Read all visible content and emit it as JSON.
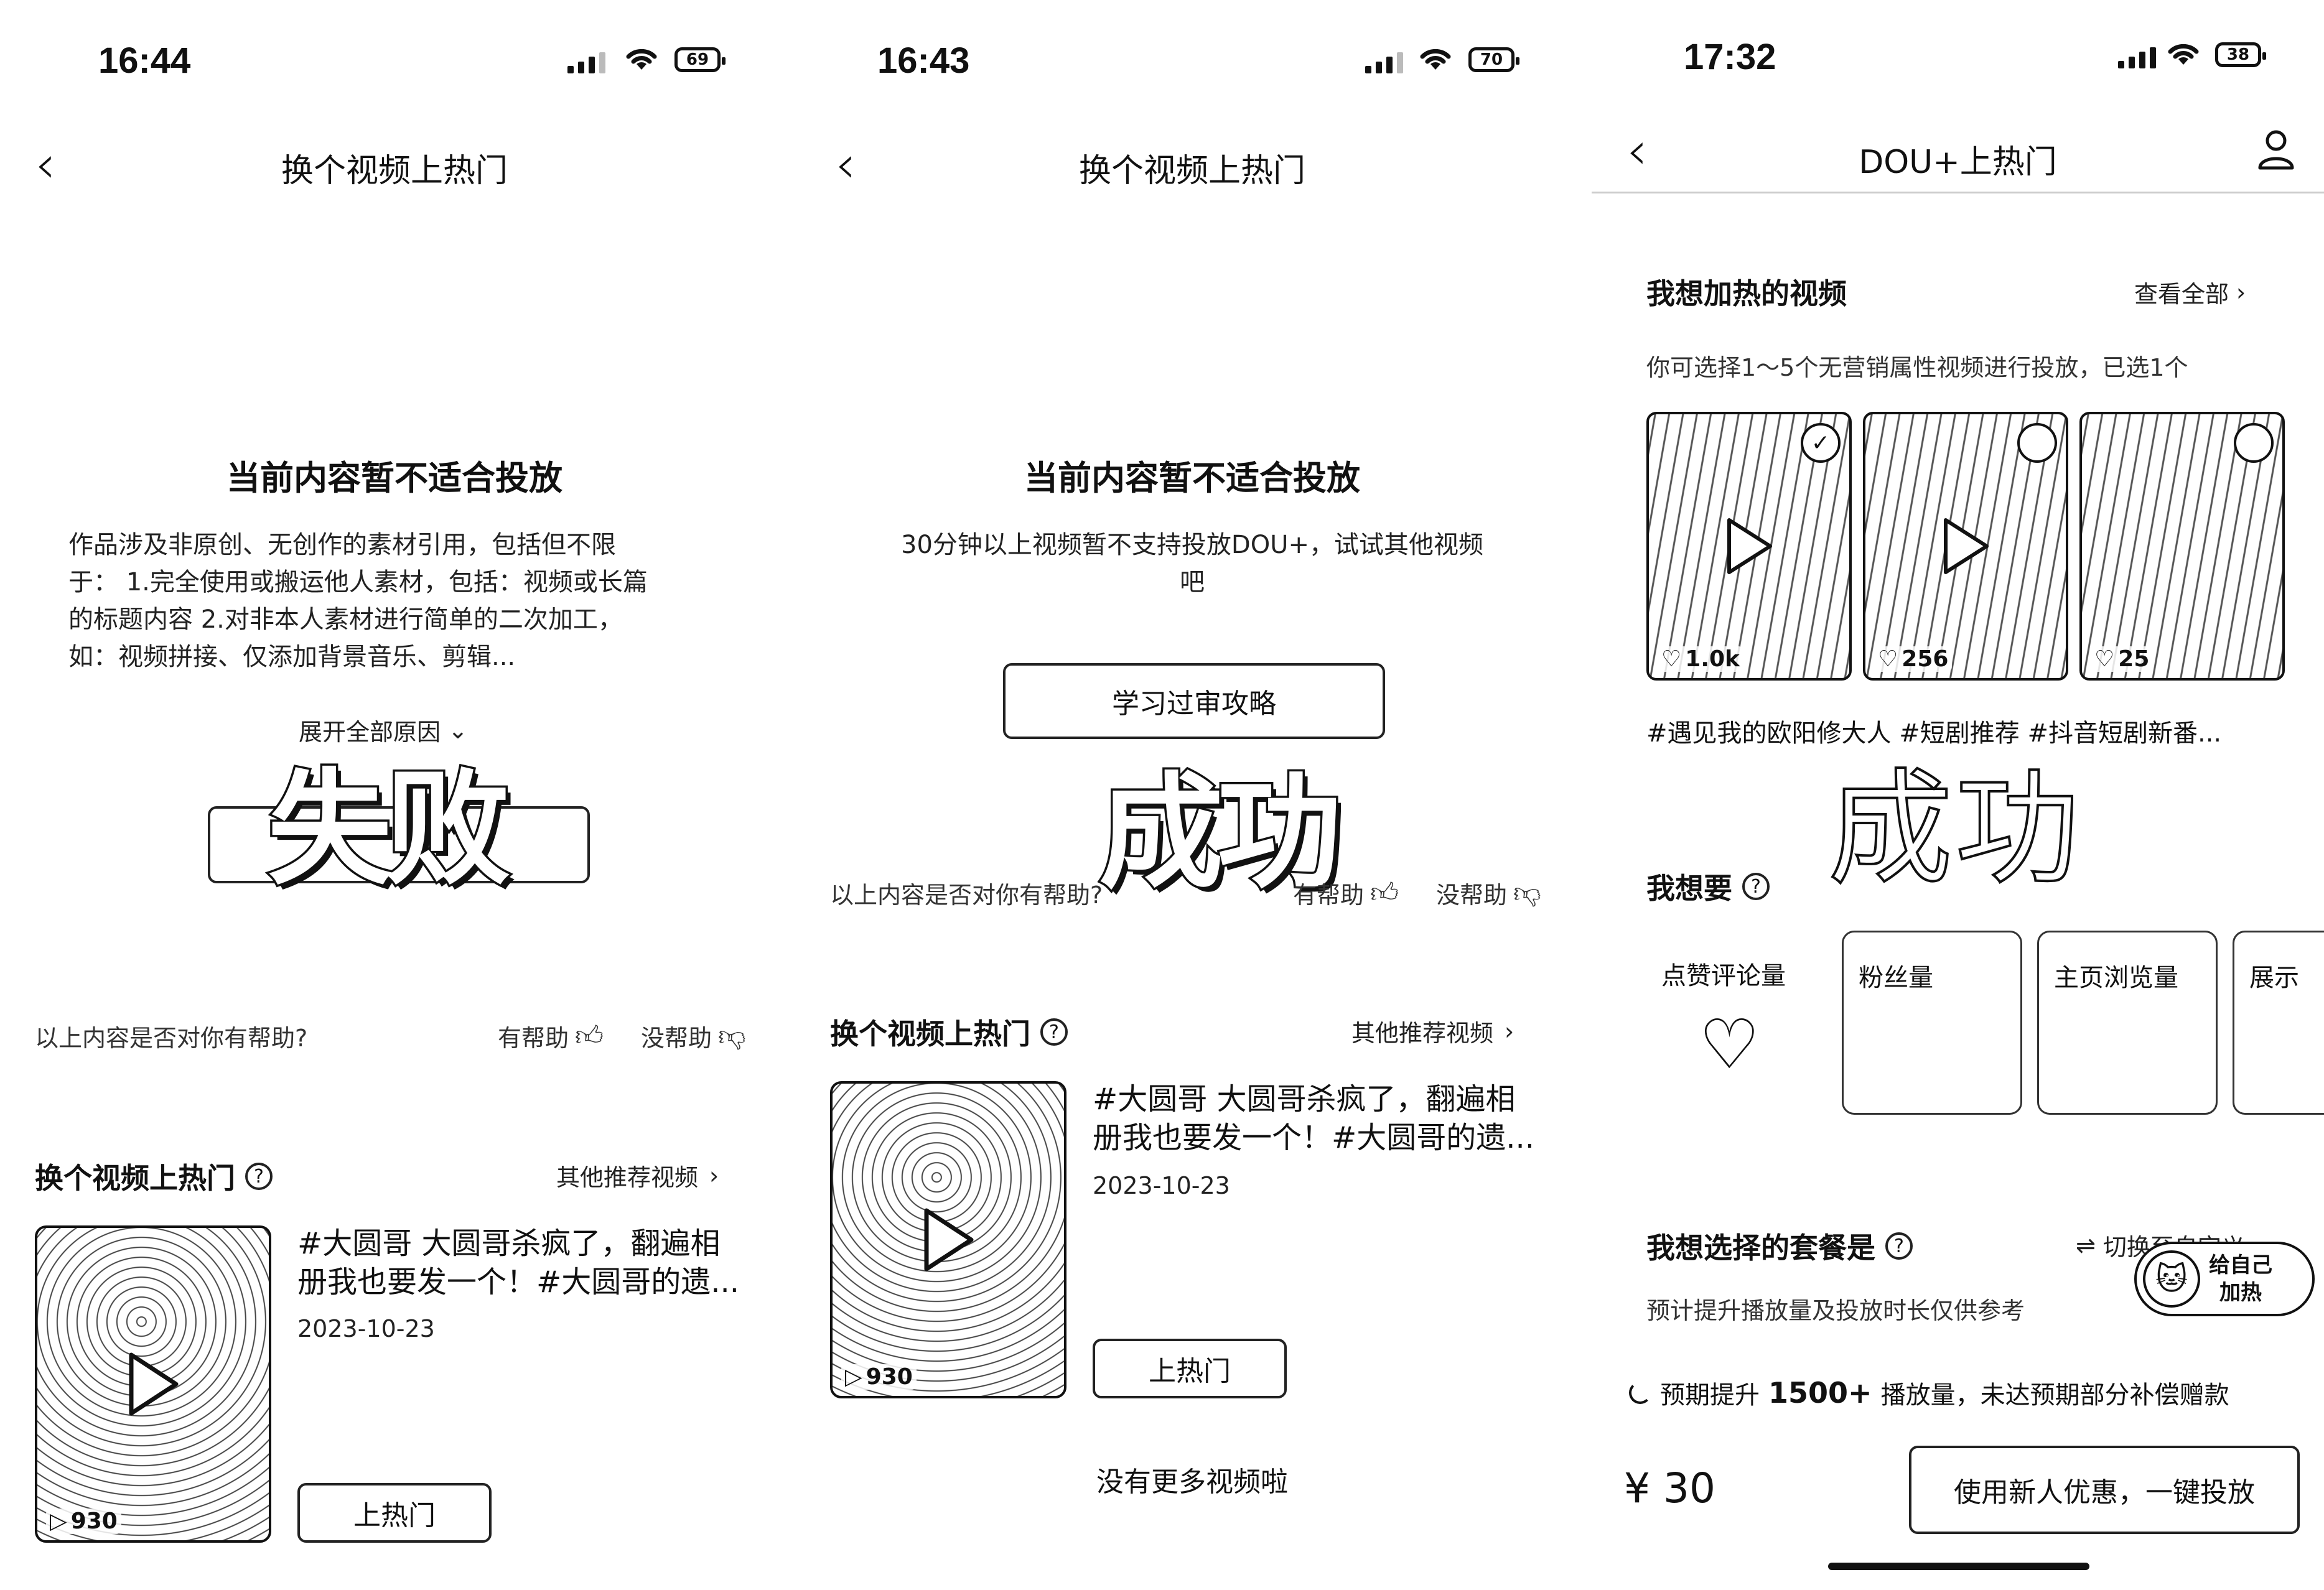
{
  "screen1": {
    "status": {
      "time": "16:44",
      "battery": "69"
    },
    "nav": {
      "title": "换个视频上热门"
    },
    "heading": "当前内容暂不适合投放",
    "body_lines": [
      "作品涉及非原创、无创作的素材引用，包括但不限",
      "于：  1.完全使用或搬运他人素材，包括：视频或长篇",
      "的标题内容 2.对非本人素材进行简单的二次加工，",
      "如：视频拼接、仅添加背景音乐、剪辑..."
    ],
    "expand": "展开全部原因",
    "stamp": "失败",
    "helpful_question": "以上内容是否对你有帮助?",
    "helpful_yes": "有帮助",
    "helpful_no": "没帮助",
    "section_title": "换个视频上热门",
    "section_link": "其他推荐视频",
    "video": {
      "title_line1": "#大圆哥 大圆哥杀疯了，翻遍相",
      "title_line2": "册我也要发一个！#大圆哥的遗...",
      "date": "2023-10-23",
      "plays": "930",
      "button": "上热门"
    }
  },
  "screen2": {
    "status": {
      "time": "16:43",
      "battery": "70"
    },
    "nav": {
      "title": "换个视频上热门"
    },
    "heading": "当前内容暂不适合投放",
    "body_line1": "30分钟以上视频暂不支持投放DOU+，试试其他视频",
    "body_line2": "吧",
    "guide_button": "学习过审攻略",
    "stamp": "成功",
    "helpful_question": "以上内容是否对你有帮助?",
    "helpful_yes": "有帮助",
    "helpful_no": "没帮助",
    "section_title": "换个视频上热门",
    "section_link": "其他推荐视频",
    "video": {
      "title_line1": "#大圆哥 大圆哥杀疯了，翻遍相",
      "title_line2": "册我也要发一个！#大圆哥的遗...",
      "date": "2023-10-23",
      "plays": "930",
      "button": "上热门"
    },
    "no_more": "没有更多视频啦"
  },
  "screen3": {
    "status": {
      "time": "17:32",
      "battery": "38"
    },
    "nav": {
      "title": "DOU+上热门"
    },
    "videos_title": "我想加热的视频",
    "view_all": "查看全部",
    "videos_sub": "你可选择1～5个无营销属性视频进行投放，已选1个",
    "thumbs": [
      {
        "likes": "1.0k"
      },
      {
        "likes": "256"
      },
      {
        "likes": "25"
      }
    ],
    "hashtags": "#遇见我的欧阳修大人 #短剧推荐 #抖音短剧新番...",
    "stamp": "成功",
    "want_title": "我想要",
    "want_options": [
      "点赞评论量",
      "粉丝量",
      "主页浏览量",
      "展示"
    ],
    "package_title": "我想选择的套餐是",
    "switch_custom": "切换至自定义",
    "package_sub": "预计提升播放量及投放时长仅供参考",
    "float_label_1": "给自己",
    "float_label_2": "加热",
    "expect_pre": "预期提升",
    "expect_num": "1500+",
    "expect_post": "播放量，未达预期部分补偿赠款",
    "price": "¥ 30",
    "submit": "使用新人优惠，一键投放"
  }
}
